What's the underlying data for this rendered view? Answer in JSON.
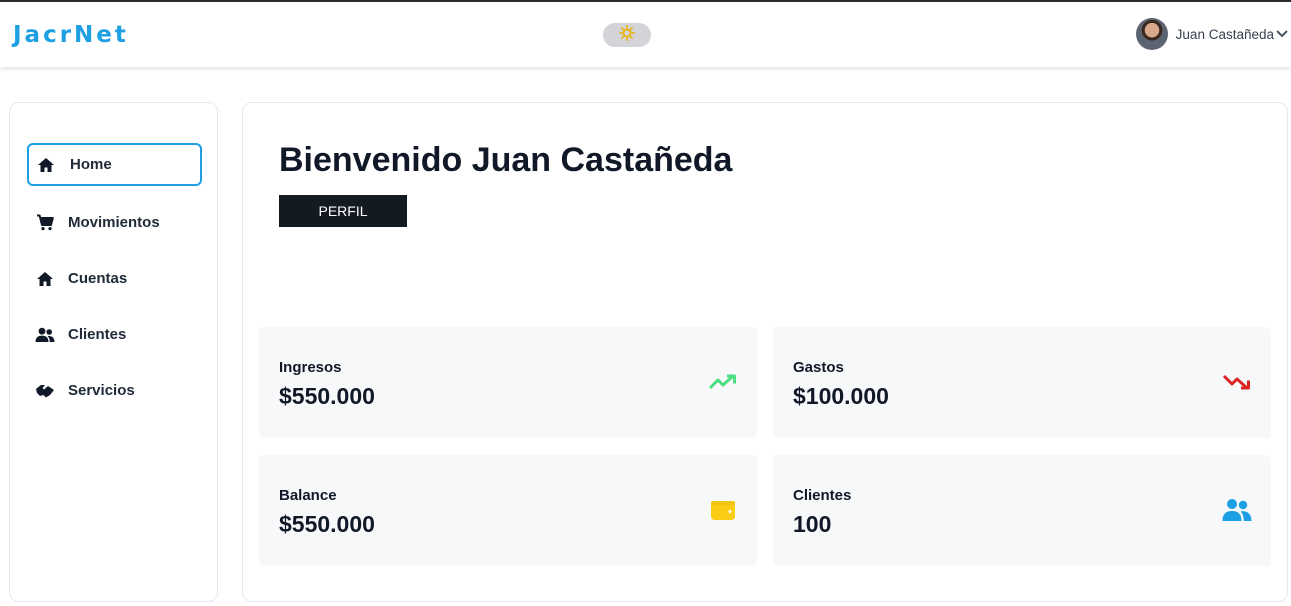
{
  "header": {
    "brand": "JacrNet",
    "theme_icon": "sun-icon",
    "user_name": "Juan Castañeda",
    "user_menu_icon": "chevron-down-icon"
  },
  "sidebar": {
    "items": [
      {
        "label": "Home",
        "icon": "home-icon",
        "active": true
      },
      {
        "label": "Movimientos",
        "icon": "cart-icon",
        "active": false
      },
      {
        "label": "Cuentas",
        "icon": "home-icon",
        "active": false
      },
      {
        "label": "Clientes",
        "icon": "users-icon",
        "active": false
      },
      {
        "label": "Servicios",
        "icon": "handshake-icon",
        "active": false
      }
    ]
  },
  "main": {
    "welcome": "Bienvenido Juan Castañeda",
    "profile_button": "PERFIL",
    "cards": [
      {
        "label": "Ingresos",
        "value": "$550.000",
        "icon": "trending-up-icon",
        "color": "#4ade80"
      },
      {
        "label": "Gastos",
        "value": "$100.000",
        "icon": "trending-down-icon",
        "color": "#dc2626"
      },
      {
        "label": "Balance",
        "value": "$550.000",
        "icon": "wallet-icon",
        "color": "#facc15"
      },
      {
        "label": "Clientes",
        "value": "100",
        "icon": "users-icon",
        "color": "#1d9fe4"
      }
    ]
  },
  "colors": {
    "accent": "#1d9fe4",
    "sun": "#eab308",
    "dark_button": "#141a22"
  }
}
